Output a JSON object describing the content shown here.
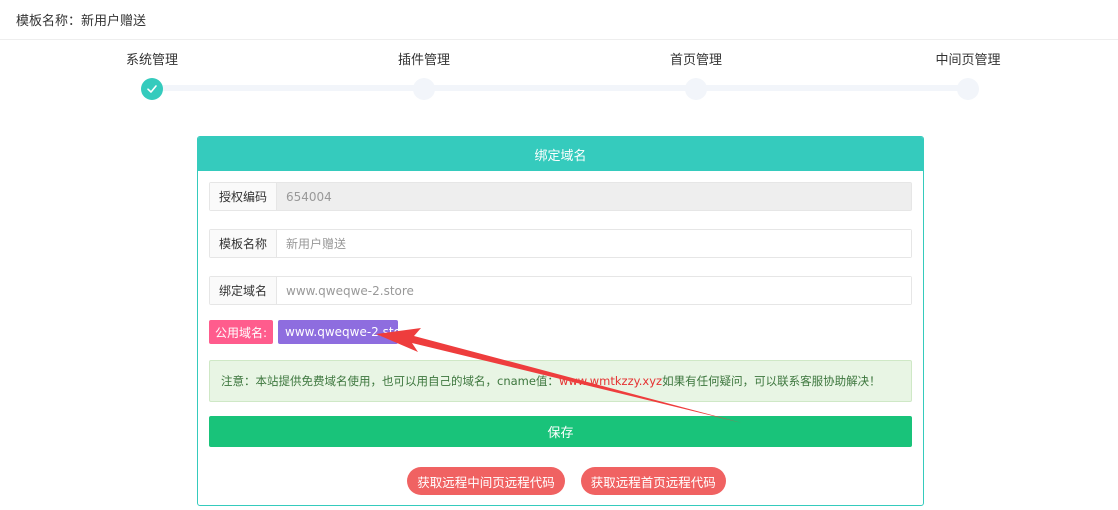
{
  "header": {
    "template_name_text": "模板名称：新用户赠送"
  },
  "steps": [
    {
      "label": "系统管理",
      "status": "done"
    },
    {
      "label": "插件管理",
      "status": "pending"
    },
    {
      "label": "首页管理",
      "status": "pending"
    },
    {
      "label": "中间页管理",
      "status": "pending"
    }
  ],
  "panel": {
    "title": "绑定域名",
    "fields": [
      {
        "label": "授权编码",
        "value": "654004",
        "readonly": true
      },
      {
        "label": "模板名称",
        "value": "新用户赠送",
        "readonly": false
      },
      {
        "label": "绑定域名",
        "value": "www.qweqwe-2.store",
        "readonly": false
      }
    ],
    "public_domain": {
      "label": "公用域名:",
      "value": "www.qweqwe-2.store"
    },
    "notice": {
      "prefix": "注意：本站提供免费域名使用，也可以用自己的域名，cname值：",
      "cname": "www.wmtkzzy.xyz",
      "suffix": " 如果有任何疑问，可以联系客服协助解决！"
    },
    "save_label": "保存",
    "buttons": {
      "get_middle_code": "获取远程中间页远程代码",
      "get_home_code": "获取远程首页远程代码"
    }
  },
  "colors": {
    "teal": "#35cbbd",
    "green": "#19c37a",
    "pink": "#ff5c8d",
    "purple": "#8e6ddf",
    "red": "#f06262",
    "arrow": "#ee3d3d"
  }
}
